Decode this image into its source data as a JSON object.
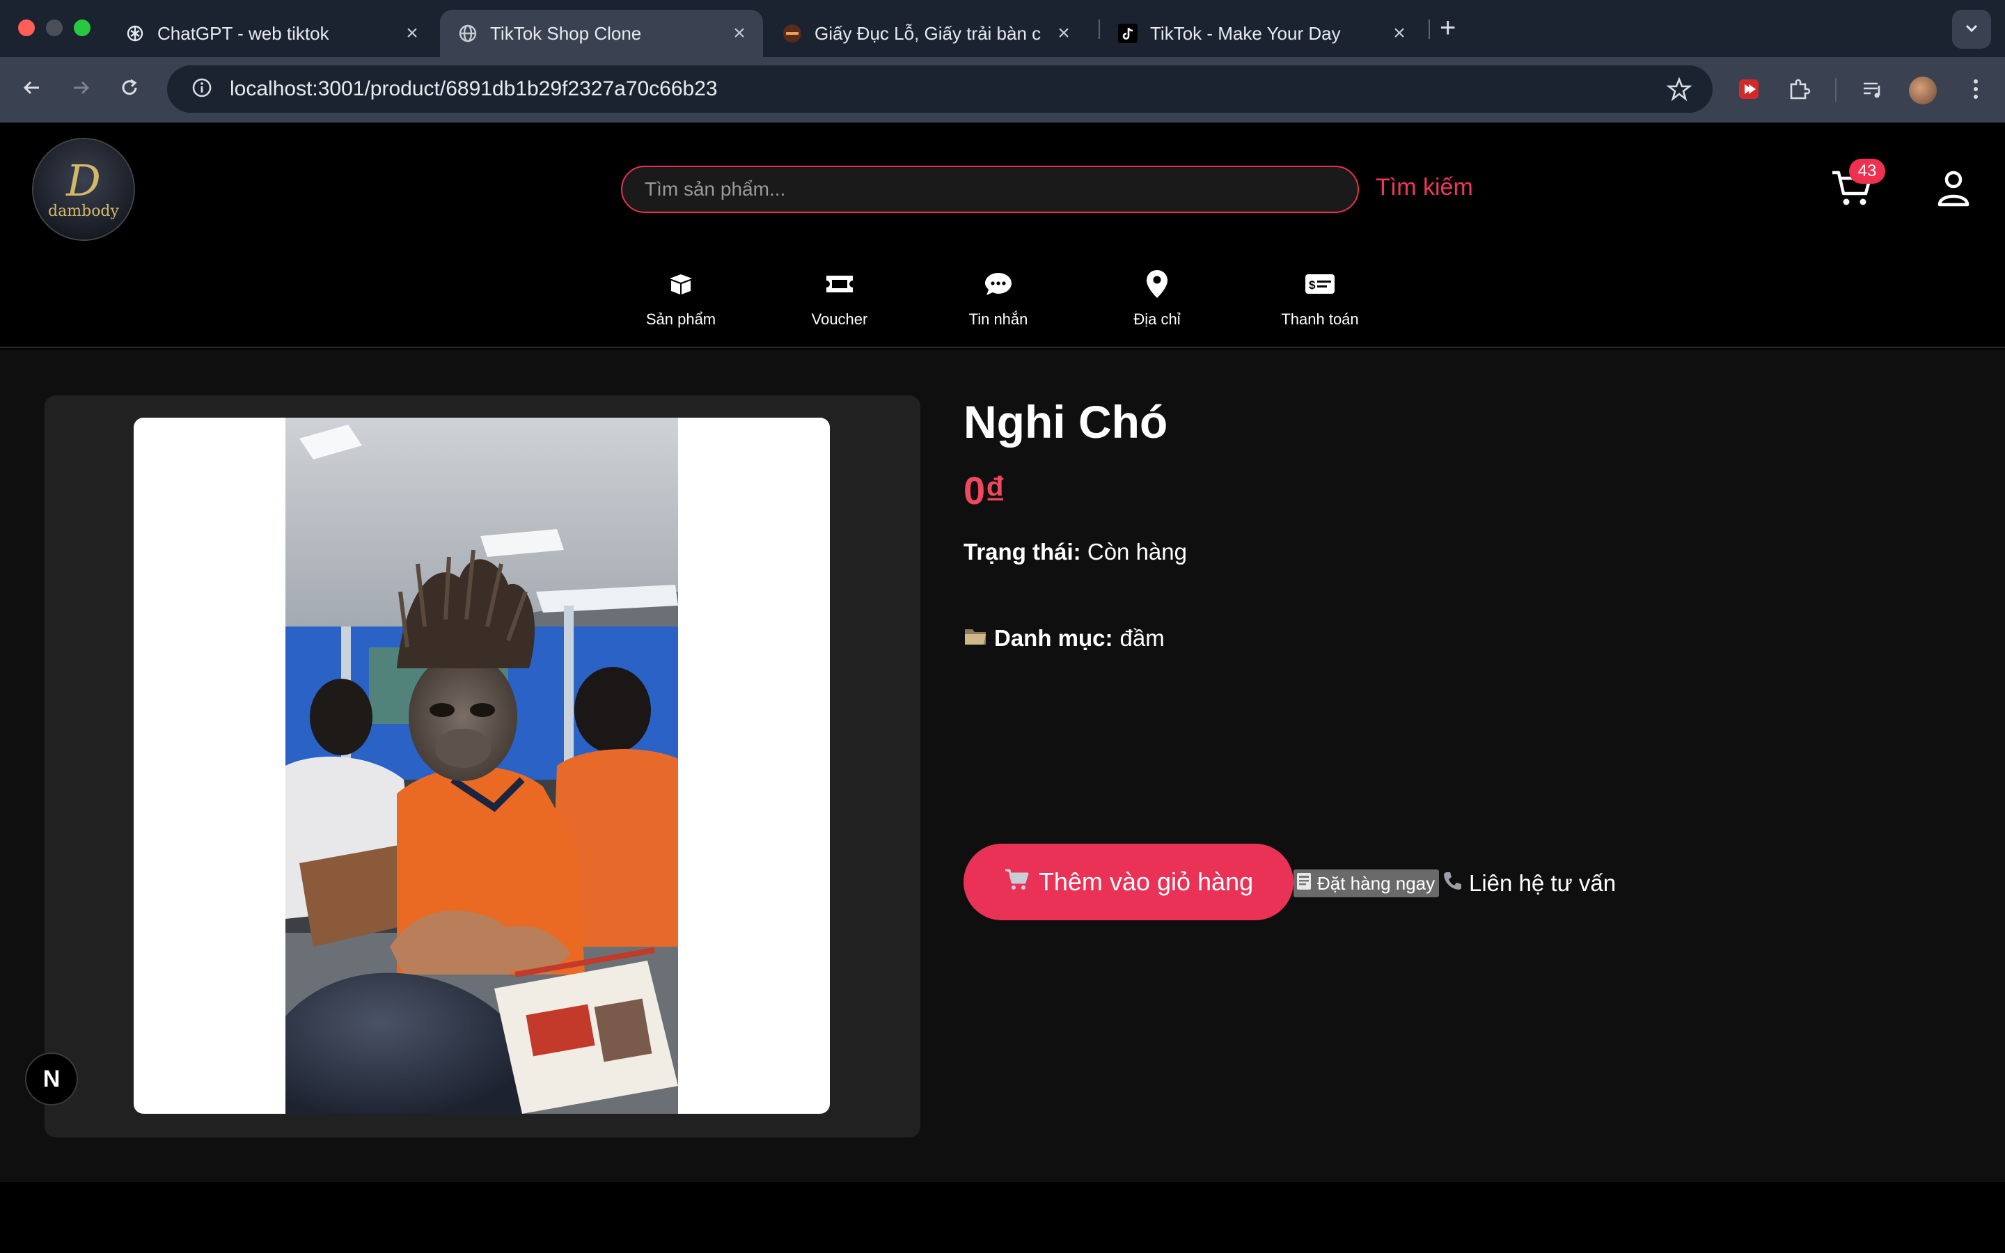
{
  "browser": {
    "tabs": [
      {
        "title": "ChatGPT - web tiktok",
        "active": false
      },
      {
        "title": "TikTok Shop Clone",
        "active": true
      },
      {
        "title": "Giấy Đục Lỗ, Giấy trải bàn cắt",
        "active": false
      },
      {
        "title": "TikTok - Make Your Day",
        "active": false
      }
    ],
    "new_tab": "+",
    "url": "localhost:3001/product/6891db1b29f2327a70c66b23"
  },
  "header": {
    "logo_mark": "D",
    "logo_text": "dambody",
    "search_placeholder": "Tìm sản phẩm...",
    "search_button": "Tìm kiếm",
    "cart_count": "43"
  },
  "nav": {
    "items": [
      {
        "label": "Sản phẩm",
        "icon": "box-icon"
      },
      {
        "label": "Voucher",
        "icon": "ticket-icon"
      },
      {
        "label": "Tin nhắn",
        "icon": "chat-icon"
      },
      {
        "label": "Địa chỉ",
        "icon": "location-pin-icon"
      },
      {
        "label": "Thanh toán",
        "icon": "payment-card-icon"
      }
    ]
  },
  "product": {
    "name": "Nghi Chó",
    "price": "0₫",
    "status_label": "Trạng thái:",
    "status_value": "Còn hàng",
    "category_label": "Danh mục:",
    "category_value": "đầm",
    "add_to_cart": "Thêm vào giỏ hàng",
    "order_now": "Đặt hàng ngay",
    "contact": "Liên hệ tư vấn"
  },
  "dev": {
    "badge": "N"
  },
  "colors": {
    "accent": "#ea3156",
    "price": "#f2485f",
    "page_bg": "#0f0f0f"
  }
}
